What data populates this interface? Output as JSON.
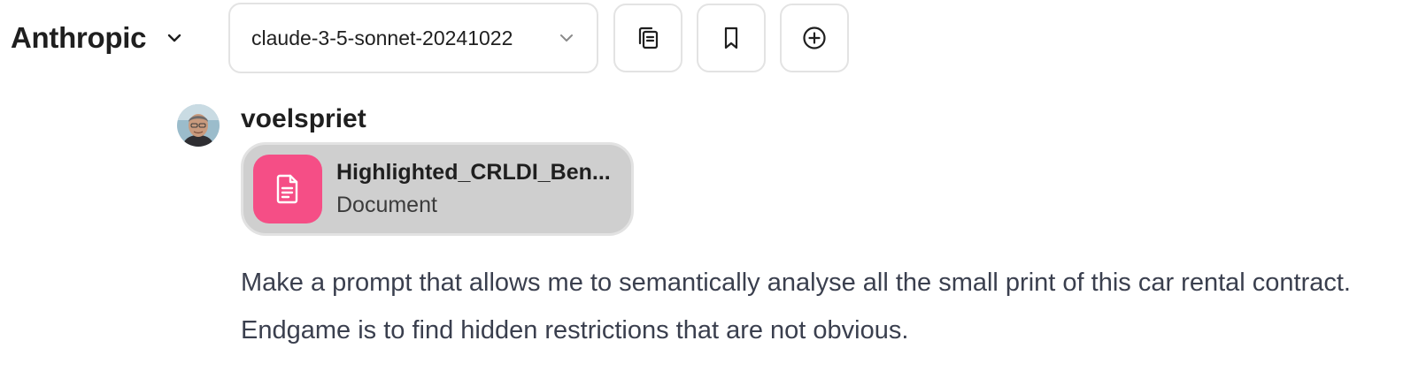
{
  "header": {
    "provider": "Anthropic",
    "provider_icon": "chevron-down-icon",
    "model": "claude-3-5-sonnet-20241022",
    "model_icon": "chevron-down-icon",
    "actions": [
      "copy-icon",
      "bookmark-icon",
      "plus-circle-icon"
    ]
  },
  "message": {
    "username": "voelspriet",
    "attachment": {
      "name": "Highlighted_CRLDI_Ben...",
      "type": "Document",
      "icon": "document-icon",
      "icon_color": "#f54e86"
    },
    "text": "Make a prompt that allows me to semantically analyse all the small print of this car rental contract. Endgame is to find hidden restrictions that are not obvious."
  }
}
